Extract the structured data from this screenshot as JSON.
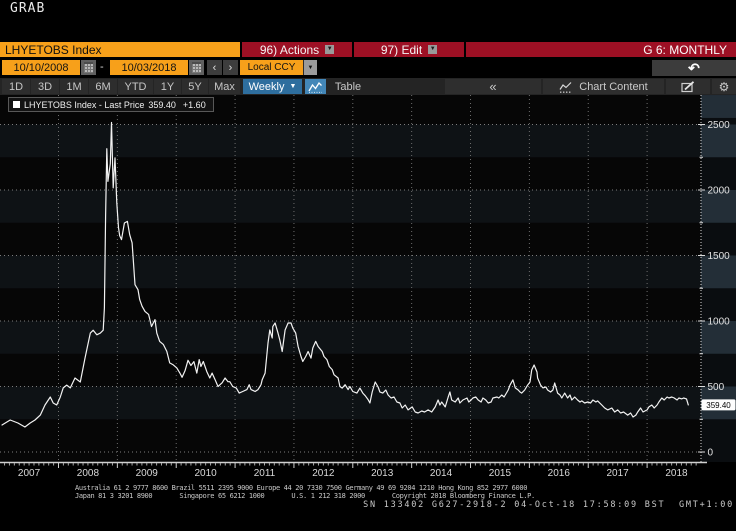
{
  "window": {
    "grab": "GRAB"
  },
  "security_bar": {
    "ticker": "LHYETOBS Index",
    "actions": "96) Actions",
    "edit": "97) Edit",
    "page": "G 6: MONTHLY"
  },
  "date_controls": {
    "date_from": "10/10/2008",
    "separator": "-",
    "date_to": "10/03/2018",
    "prev": "‹",
    "next": "›",
    "currency": "Local CCY"
  },
  "icons": {
    "menu_caret": "▼",
    "dropdown_caret": "▼",
    "undo": "↶",
    "collapse": "«",
    "period_caret": "▼",
    "gear": "⚙"
  },
  "toolbar": {
    "ranges": [
      "1D",
      "3D",
      "1M",
      "6M",
      "YTD",
      "1Y",
      "5Y",
      "Max"
    ],
    "period": "Weekly",
    "table": "Table",
    "chart_content": "Chart Content"
  },
  "legend": {
    "label": "LHYETOBS Index - Last Price",
    "value": "359.40",
    "change": "+1.60"
  },
  "chart_data": {
    "type": "line",
    "title": "LHYETOBS Index - Last Price",
    "last_price": 359.4,
    "change": 1.6,
    "ylim": [
      0,
      2725
    ],
    "y_ticks": [
      0,
      500,
      1000,
      1500,
      2000,
      2500
    ],
    "x_ticks": [
      2007,
      2008,
      2009,
      2010,
      2011,
      2012,
      2013,
      2014,
      2015,
      2016,
      2017,
      2018
    ],
    "grid": true,
    "series": [
      {
        "name": "LHYETOBS Index",
        "points": [
          [
            2007.04,
            206
          ],
          [
            2007.18,
            244
          ],
          [
            2007.31,
            221
          ],
          [
            2007.43,
            191
          ],
          [
            2007.52,
            221
          ],
          [
            2007.6,
            244
          ],
          [
            2007.69,
            282
          ],
          [
            2007.77,
            359
          ],
          [
            2007.86,
            420
          ],
          [
            2007.91,
            374
          ],
          [
            2007.97,
            359
          ],
          [
            2008.03,
            420
          ],
          [
            2008.08,
            489
          ],
          [
            2008.14,
            511
          ],
          [
            2008.2,
            489
          ],
          [
            2008.28,
            565
          ],
          [
            2008.37,
            534
          ],
          [
            2008.45,
            717
          ],
          [
            2008.54,
            908
          ],
          [
            2008.59,
            930
          ],
          [
            2008.65,
            895
          ],
          [
            2008.71,
            908
          ],
          [
            2008.76,
            930
          ],
          [
            2008.78,
            1100
          ],
          [
            2008.8,
            1800
          ],
          [
            2008.82,
            2315
          ],
          [
            2008.84,
            2066
          ],
          [
            2008.88,
            2200
          ],
          [
            2008.9,
            2515
          ],
          [
            2008.93,
            2016
          ],
          [
            2008.96,
            2245
          ],
          [
            2008.99,
            1900
          ],
          [
            2009.02,
            1712
          ],
          [
            2009.04,
            1650
          ],
          [
            2009.07,
            1621
          ],
          [
            2009.12,
            1748
          ],
          [
            2009.17,
            1760
          ],
          [
            2009.21,
            1659
          ],
          [
            2009.25,
            1597
          ],
          [
            2009.3,
            1277
          ],
          [
            2009.35,
            1239
          ],
          [
            2009.38,
            1163
          ],
          [
            2009.42,
            1112
          ],
          [
            2009.47,
            1073
          ],
          [
            2009.53,
            1050
          ],
          [
            2009.58,
            958
          ],
          [
            2009.64,
            1011
          ],
          [
            2009.67,
            908
          ],
          [
            2009.72,
            844
          ],
          [
            2009.78,
            821
          ],
          [
            2009.84,
            768
          ],
          [
            2009.89,
            680
          ],
          [
            2009.95,
            665
          ],
          [
            2010.01,
            642
          ],
          [
            2010.06,
            604
          ],
          [
            2010.1,
            570
          ],
          [
            2010.15,
            620
          ],
          [
            2010.2,
            700
          ],
          [
            2010.25,
            660
          ],
          [
            2010.3,
            690
          ],
          [
            2010.35,
            602
          ],
          [
            2010.39,
            705
          ],
          [
            2010.42,
            653
          ],
          [
            2010.46,
            691
          ],
          [
            2010.52,
            614
          ],
          [
            2010.57,
            565
          ],
          [
            2010.61,
            602
          ],
          [
            2010.66,
            552
          ],
          [
            2010.71,
            500
          ],
          [
            2010.78,
            528
          ],
          [
            2010.83,
            565
          ],
          [
            2010.88,
            537
          ],
          [
            2010.91,
            537
          ],
          [
            2010.96,
            500
          ],
          [
            2011.02,
            488
          ],
          [
            2011.07,
            450
          ],
          [
            2011.13,
            462
          ],
          [
            2011.2,
            476
          ],
          [
            2011.24,
            514
          ],
          [
            2011.27,
            476
          ],
          [
            2011.34,
            462
          ],
          [
            2011.39,
            476
          ],
          [
            2011.44,
            514
          ],
          [
            2011.46,
            552
          ],
          [
            2011.51,
            602
          ],
          [
            2011.56,
            832
          ],
          [
            2011.59,
            931
          ],
          [
            2011.63,
            870
          ],
          [
            2011.64,
            957
          ],
          [
            2011.68,
            985
          ],
          [
            2011.73,
            908
          ],
          [
            2011.76,
            855
          ],
          [
            2011.8,
            767
          ],
          [
            2011.85,
            931
          ],
          [
            2011.9,
            985
          ],
          [
            2011.95,
            985
          ],
          [
            2011.98,
            946
          ],
          [
            2012.03,
            908
          ],
          [
            2012.07,
            805
          ],
          [
            2012.12,
            729
          ],
          [
            2012.15,
            691
          ],
          [
            2012.2,
            729
          ],
          [
            2012.24,
            767
          ],
          [
            2012.29,
            717
          ],
          [
            2012.32,
            794
          ],
          [
            2012.37,
            844
          ],
          [
            2012.41,
            805
          ],
          [
            2012.48,
            767
          ],
          [
            2012.51,
            729
          ],
          [
            2012.56,
            705
          ],
          [
            2012.6,
            653
          ],
          [
            2012.65,
            629
          ],
          [
            2012.68,
            590
          ],
          [
            2012.75,
            565
          ],
          [
            2012.78,
            500
          ],
          [
            2012.82,
            488
          ],
          [
            2012.87,
            514
          ],
          [
            2012.92,
            476
          ],
          [
            2012.95,
            500
          ],
          [
            2013.0,
            462
          ],
          [
            2013.07,
            450
          ],
          [
            2013.12,
            488
          ],
          [
            2013.17,
            450
          ],
          [
            2013.21,
            430
          ],
          [
            2013.26,
            400
          ],
          [
            2013.29,
            374
          ],
          [
            2013.33,
            458
          ],
          [
            2013.38,
            534
          ],
          [
            2013.43,
            496
          ],
          [
            2013.46,
            458
          ],
          [
            2013.51,
            450
          ],
          [
            2013.56,
            473
          ],
          [
            2013.6,
            435
          ],
          [
            2013.65,
            412
          ],
          [
            2013.7,
            420
          ],
          [
            2013.75,
            382
          ],
          [
            2013.8,
            374
          ],
          [
            2013.84,
            336
          ],
          [
            2013.89,
            359
          ],
          [
            2013.94,
            321
          ],
          [
            2014.01,
            344
          ],
          [
            2014.06,
            305
          ],
          [
            2014.11,
            298
          ],
          [
            2014.17,
            313
          ],
          [
            2014.22,
            305
          ],
          [
            2014.28,
            321
          ],
          [
            2014.34,
            305
          ],
          [
            2014.4,
            344
          ],
          [
            2014.45,
            397
          ],
          [
            2014.48,
            359
          ],
          [
            2014.51,
            382
          ],
          [
            2014.57,
            344
          ],
          [
            2014.62,
            420
          ],
          [
            2014.65,
            458
          ],
          [
            2014.68,
            397
          ],
          [
            2014.74,
            382
          ],
          [
            2014.79,
            412
          ],
          [
            2014.82,
            374
          ],
          [
            2014.87,
            397
          ],
          [
            2014.94,
            412
          ],
          [
            2014.97,
            382
          ],
          [
            2015.01,
            397
          ],
          [
            2015.04,
            412
          ],
          [
            2015.09,
            420
          ],
          [
            2015.13,
            397
          ],
          [
            2015.18,
            382
          ],
          [
            2015.21,
            412
          ],
          [
            2015.26,
            397
          ],
          [
            2015.3,
            374
          ],
          [
            2015.35,
            382
          ],
          [
            2015.38,
            412
          ],
          [
            2015.45,
            420
          ],
          [
            2015.48,
            412
          ],
          [
            2015.53,
            435
          ],
          [
            2015.57,
            420
          ],
          [
            2015.64,
            473
          ],
          [
            2015.67,
            511
          ],
          [
            2015.72,
            550
          ],
          [
            2015.76,
            489
          ],
          [
            2015.81,
            473
          ],
          [
            2015.84,
            458
          ],
          [
            2015.87,
            450
          ],
          [
            2015.92,
            473
          ],
          [
            2015.97,
            511
          ],
          [
            2016.01,
            534
          ],
          [
            2016.04,
            626
          ],
          [
            2016.08,
            664
          ],
          [
            2016.13,
            611
          ],
          [
            2016.14,
            565
          ],
          [
            2016.19,
            511
          ],
          [
            2016.23,
            489
          ],
          [
            2016.28,
            496
          ],
          [
            2016.31,
            473
          ],
          [
            2016.36,
            458
          ],
          [
            2016.4,
            473
          ],
          [
            2016.43,
            527
          ],
          [
            2016.48,
            450
          ],
          [
            2016.52,
            435
          ],
          [
            2016.55,
            412
          ],
          [
            2016.6,
            450
          ],
          [
            2016.65,
            412
          ],
          [
            2016.69,
            435
          ],
          [
            2016.72,
            397
          ],
          [
            2016.77,
            420
          ],
          [
            2016.82,
            397
          ],
          [
            2016.86,
            382
          ],
          [
            2016.89,
            390
          ],
          [
            2016.94,
            374
          ],
          [
            2016.99,
            382
          ],
          [
            2017.04,
            374
          ],
          [
            2017.08,
            397
          ],
          [
            2017.13,
            382
          ],
          [
            2017.16,
            390
          ],
          [
            2017.23,
            359
          ],
          [
            2017.28,
            336
          ],
          [
            2017.33,
            321
          ],
          [
            2017.4,
            336
          ],
          [
            2017.45,
            305
          ],
          [
            2017.5,
            321
          ],
          [
            2017.55,
            298
          ],
          [
            2017.6,
            305
          ],
          [
            2017.67,
            282
          ],
          [
            2017.72,
            298
          ],
          [
            2017.76,
            267
          ],
          [
            2017.81,
            282
          ],
          [
            2017.84,
            305
          ],
          [
            2017.89,
            336
          ],
          [
            2017.93,
            305
          ],
          [
            2018.0,
            321
          ],
          [
            2018.03,
            344
          ],
          [
            2018.08,
            359
          ],
          [
            2018.12,
            336
          ],
          [
            2018.17,
            359
          ],
          [
            2018.2,
            382
          ],
          [
            2018.25,
            412
          ],
          [
            2018.29,
            397
          ],
          [
            2018.34,
            420
          ],
          [
            2018.37,
            412
          ],
          [
            2018.42,
            420
          ],
          [
            2018.46,
            412
          ],
          [
            2018.51,
            397
          ],
          [
            2018.54,
            412
          ],
          [
            2018.59,
            405
          ],
          [
            2018.62,
            412
          ],
          [
            2018.67,
            405
          ],
          [
            2018.7,
            359.4
          ]
        ]
      }
    ]
  },
  "footer": {
    "line1": "Australia 61 2 9777 8600 Brazil 5511 2395 9000 Europe 44 20 7330 7500 Germany 49 69 9204 1210 Hong Kong 852 2977 6000",
    "line2": "Japan 81 3 3201 8900       Singapore 65 6212 1000       U.S. 1 212 318 2000       Copyright 2018 Bloomberg Finance L.P.",
    "line3": "SN 133402 G627-2918-2 04-Oct-18 17:58:09 BST  GMT+1:00"
  },
  "colors": {
    "amber": "#f7a01a",
    "red": "#9d1024",
    "blue": "#2e6e9e",
    "blue_light": "#4387b8",
    "line": "#f2f2f2",
    "grid": "#7d7d7d",
    "band_margin": "#232e37"
  }
}
